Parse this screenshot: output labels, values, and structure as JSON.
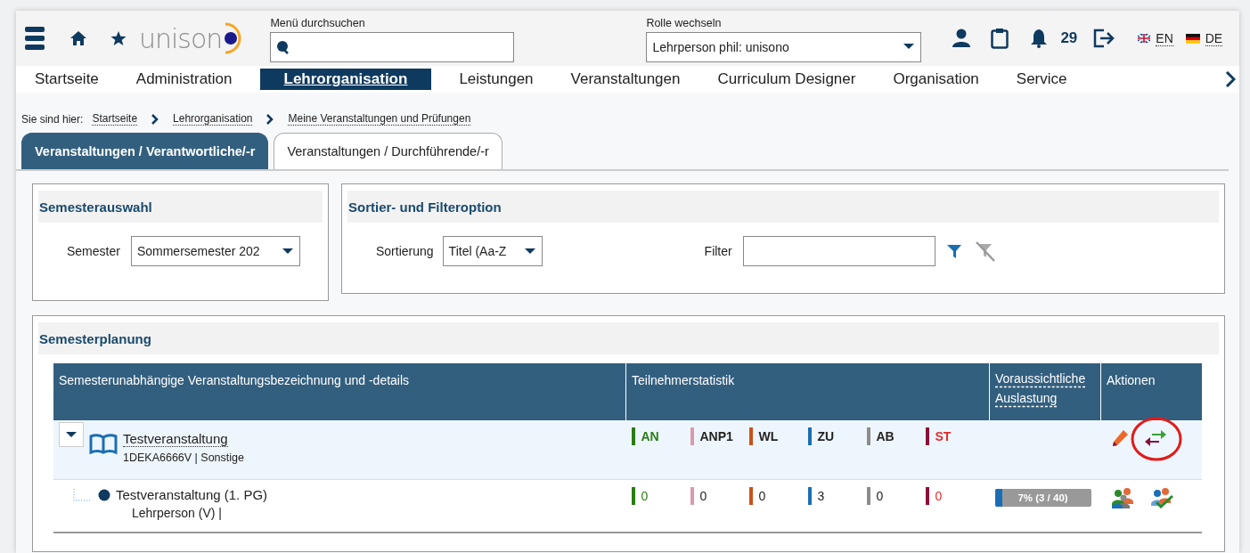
{
  "header": {
    "logo": "unison",
    "search_label": "Menü durchsuchen",
    "role": {
      "label": "Rolle wechseln",
      "value": "Lehrperson phil: unisono"
    },
    "notifications": "29",
    "languages": [
      {
        "kind": "gb",
        "code": "EN"
      },
      {
        "kind": "de",
        "code": "DE"
      }
    ]
  },
  "nav": [
    {
      "label": "Startseite",
      "selected": false
    },
    {
      "label": "Administration",
      "selected": false
    },
    {
      "label": "Lehrorganisation",
      "selected": true
    },
    {
      "label": "Leistungen",
      "selected": false
    },
    {
      "label": "Veranstaltungen",
      "selected": false
    },
    {
      "label": "Curriculum Designer",
      "selected": false
    },
    {
      "label": "Organisation",
      "selected": false
    },
    {
      "label": "Service",
      "selected": false
    }
  ],
  "breadcrumb": {
    "label": "Sie sind hier:",
    "items": [
      "Startseite",
      "Lehrorganisation",
      "Meine Veranstaltungen und Prüfungen"
    ]
  },
  "tabs": [
    {
      "label": "Veranstaltungen / Verantwortliche/-r",
      "selected": true
    },
    {
      "label": "Veranstaltungen / Durchführende/-r",
      "selected": false
    }
  ],
  "semester_panel": {
    "title": "Semesterauswahl",
    "label": "Semester",
    "value": "Sommersemester 202"
  },
  "filter_panel": {
    "title": "Sortier- und Filteroption",
    "sort_label": "Sortierung",
    "sort_value": "Titel (Aa-Z",
    "filter_label": "Filter"
  },
  "planning": {
    "title": "Semesterplanung",
    "columns": [
      "Semesterunabhängige Veranstaltungsbezeichnung und -details",
      "Teilnehmerstatistik",
      "Voraussichtliche Auslastung",
      "Aktionen"
    ],
    "stats": [
      {
        "label": "AN",
        "color": "#2a7d12",
        "kind": "positive"
      },
      {
        "label": "ANP1",
        "color": "#d99aad",
        "kind": "neutral"
      },
      {
        "label": "WL",
        "color": "#c8511b",
        "kind": "neutral"
      },
      {
        "label": "ZU",
        "color": "#1a6eb5",
        "kind": "neutral"
      },
      {
        "label": "AB",
        "color": "#8c8c8c",
        "kind": "neutral"
      },
      {
        "label": "ST",
        "color": "#8b0f3b",
        "kind": "negative"
      }
    ],
    "rows": [
      {
        "kind": "course",
        "title": "Testveranstaltung",
        "details": "1DEKA6666V | Sonstige",
        "expanded": true
      },
      {
        "kind": "group",
        "title": "Testveranstaltung (1. PG)",
        "details": "Lehrperson (V) |",
        "values": [
          "0",
          "0",
          "0",
          "3",
          "0",
          "0"
        ],
        "utilization": {
          "level": 0.075,
          "reading": "7% (3 / 40)"
        }
      }
    ]
  }
}
